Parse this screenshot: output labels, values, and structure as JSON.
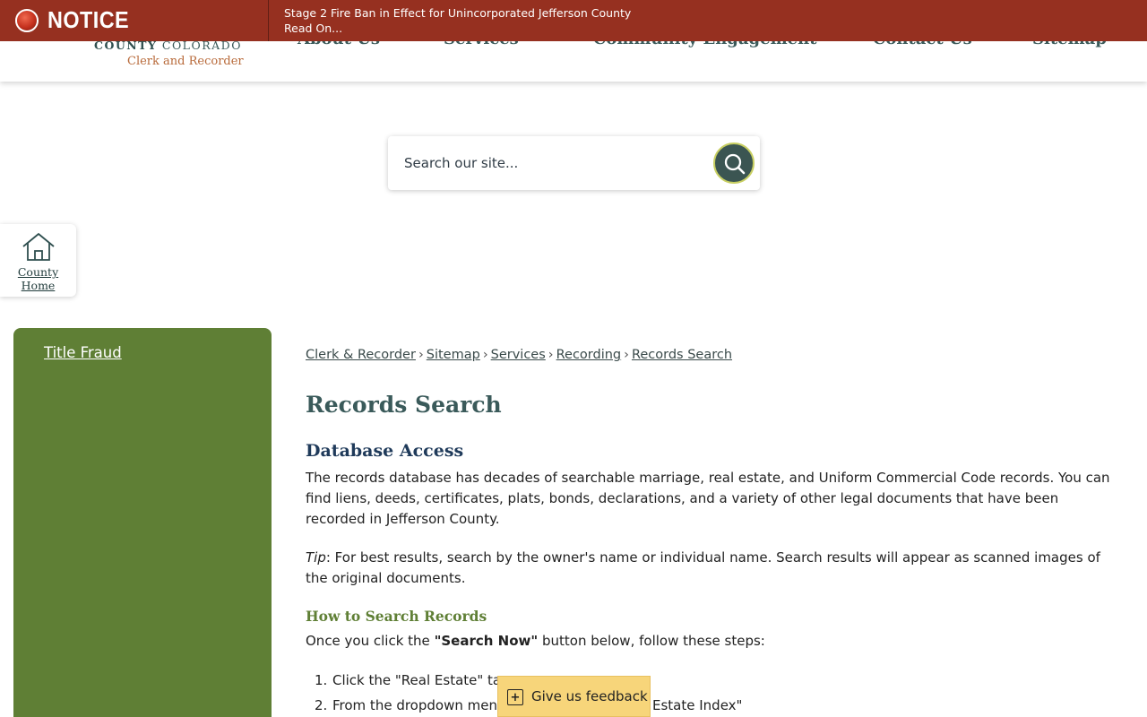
{
  "header": {
    "logo_line1_bold": "COUNTY",
    "logo_line1_light": "COLORADO",
    "logo_line2": "Clerk and Recorder",
    "nav": [
      {
        "label": "About Us"
      },
      {
        "label": "Services"
      },
      {
        "label": "Community Engagement"
      },
      {
        "label": "Contact Us"
      },
      {
        "label": "Sitemap"
      }
    ]
  },
  "notice": {
    "label": "NOTICE",
    "message": "Stage 2 Fire Ban in Effect for Unincorporated Jefferson County",
    "link": "Read On..."
  },
  "search": {
    "placeholder": "Search our site..."
  },
  "county_home": {
    "line1": "County",
    "line2": "Home"
  },
  "sidebar": {
    "items": [
      {
        "label": "Title Fraud"
      }
    ]
  },
  "breadcrumb": [
    {
      "label": "Clerk & Recorder"
    },
    {
      "label": "Sitemap"
    },
    {
      "label": "Services"
    },
    {
      "label": "Recording"
    },
    {
      "label": "Records Search"
    }
  ],
  "breadcrumb_separator": "›",
  "main": {
    "title": "Records Search",
    "section_title": "Database Access",
    "para1": "The records database has decades of searchable marriage, real estate, and Uniform Commercial Code records. You can find liens, deeds, certificates, plats, bonds, declarations, and a variety of other legal documents that have been recorded in Jefferson County.",
    "tip_label": "Tip",
    "tip_text": ": For best results, search by the owner's name or individual name. Search results will appear as scanned images of the original documents.",
    "subsection_title": "How to Search Records",
    "para3_before": "Once you click the ",
    "para3_bold": "\"Search Now\"",
    "para3_after": " button below, follow these steps:",
    "steps": [
      {
        "num": "1.",
        "text": "Click the \"Real Estate\" ta"
      },
      {
        "num": "2.",
        "text": "From the dropdown men"
      }
    ],
    "step2_tail": "Estate Index\""
  },
  "feedback": {
    "icon": "+",
    "label": "Give us feedback"
  },
  "colors": {
    "notice_bg": "#963020",
    "sidebar_bg": "#5f7f35",
    "heading": "#3a5a5a",
    "feedback_bg": "#f7d57a"
  }
}
